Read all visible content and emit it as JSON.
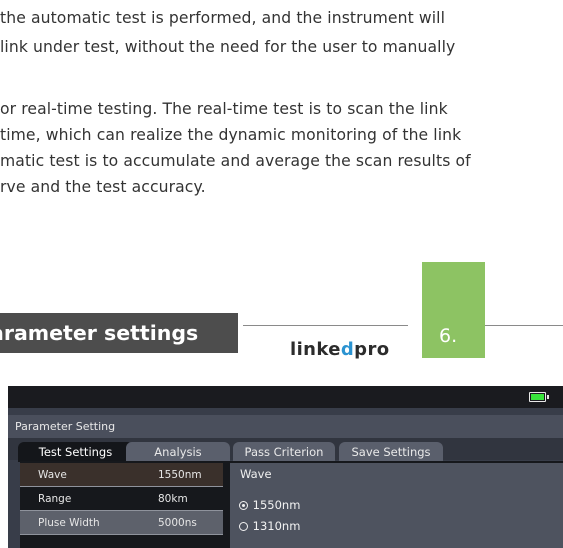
{
  "document": {
    "paragraph1": [
      "the automatic test is performed, and the instrument will",
      "link under test, without the need for the user to manually"
    ],
    "paragraph2": [
      "or real-time testing. The real-time test is to scan the link",
      "time, which can realize the dynamic monitoring of the link",
      "matic test is to accumulate and average the scan results of",
      "rve and the test accuracy."
    ],
    "section_title": "arameter settings",
    "brand_logo": "linkedpro",
    "page_number": "6."
  },
  "colors": {
    "section_bg": "#4d4d4d",
    "page_tab": "#8dc363",
    "logo_accent": "#2b93d1",
    "battery": "#39e53c",
    "device_bg": "#383d49"
  },
  "device": {
    "battery_icon": "battery-full-icon",
    "window_title": "Parameter Setting",
    "tabs": [
      {
        "label": "Test Settings",
        "active": true
      },
      {
        "label": "Analysis",
        "active": false
      },
      {
        "label": "Pass Criterion",
        "active": false
      },
      {
        "label": "Save Settings",
        "active": false
      }
    ],
    "params": [
      {
        "label": "Wave",
        "value": "1550nm"
      },
      {
        "label": "Range",
        "value": "80km"
      },
      {
        "label": "Pluse Width",
        "value": "5000ns"
      }
    ],
    "detail": {
      "title": "Wave",
      "options": [
        {
          "label": "1550nm",
          "selected": true
        },
        {
          "label": "1310nm",
          "selected": false
        }
      ]
    }
  }
}
